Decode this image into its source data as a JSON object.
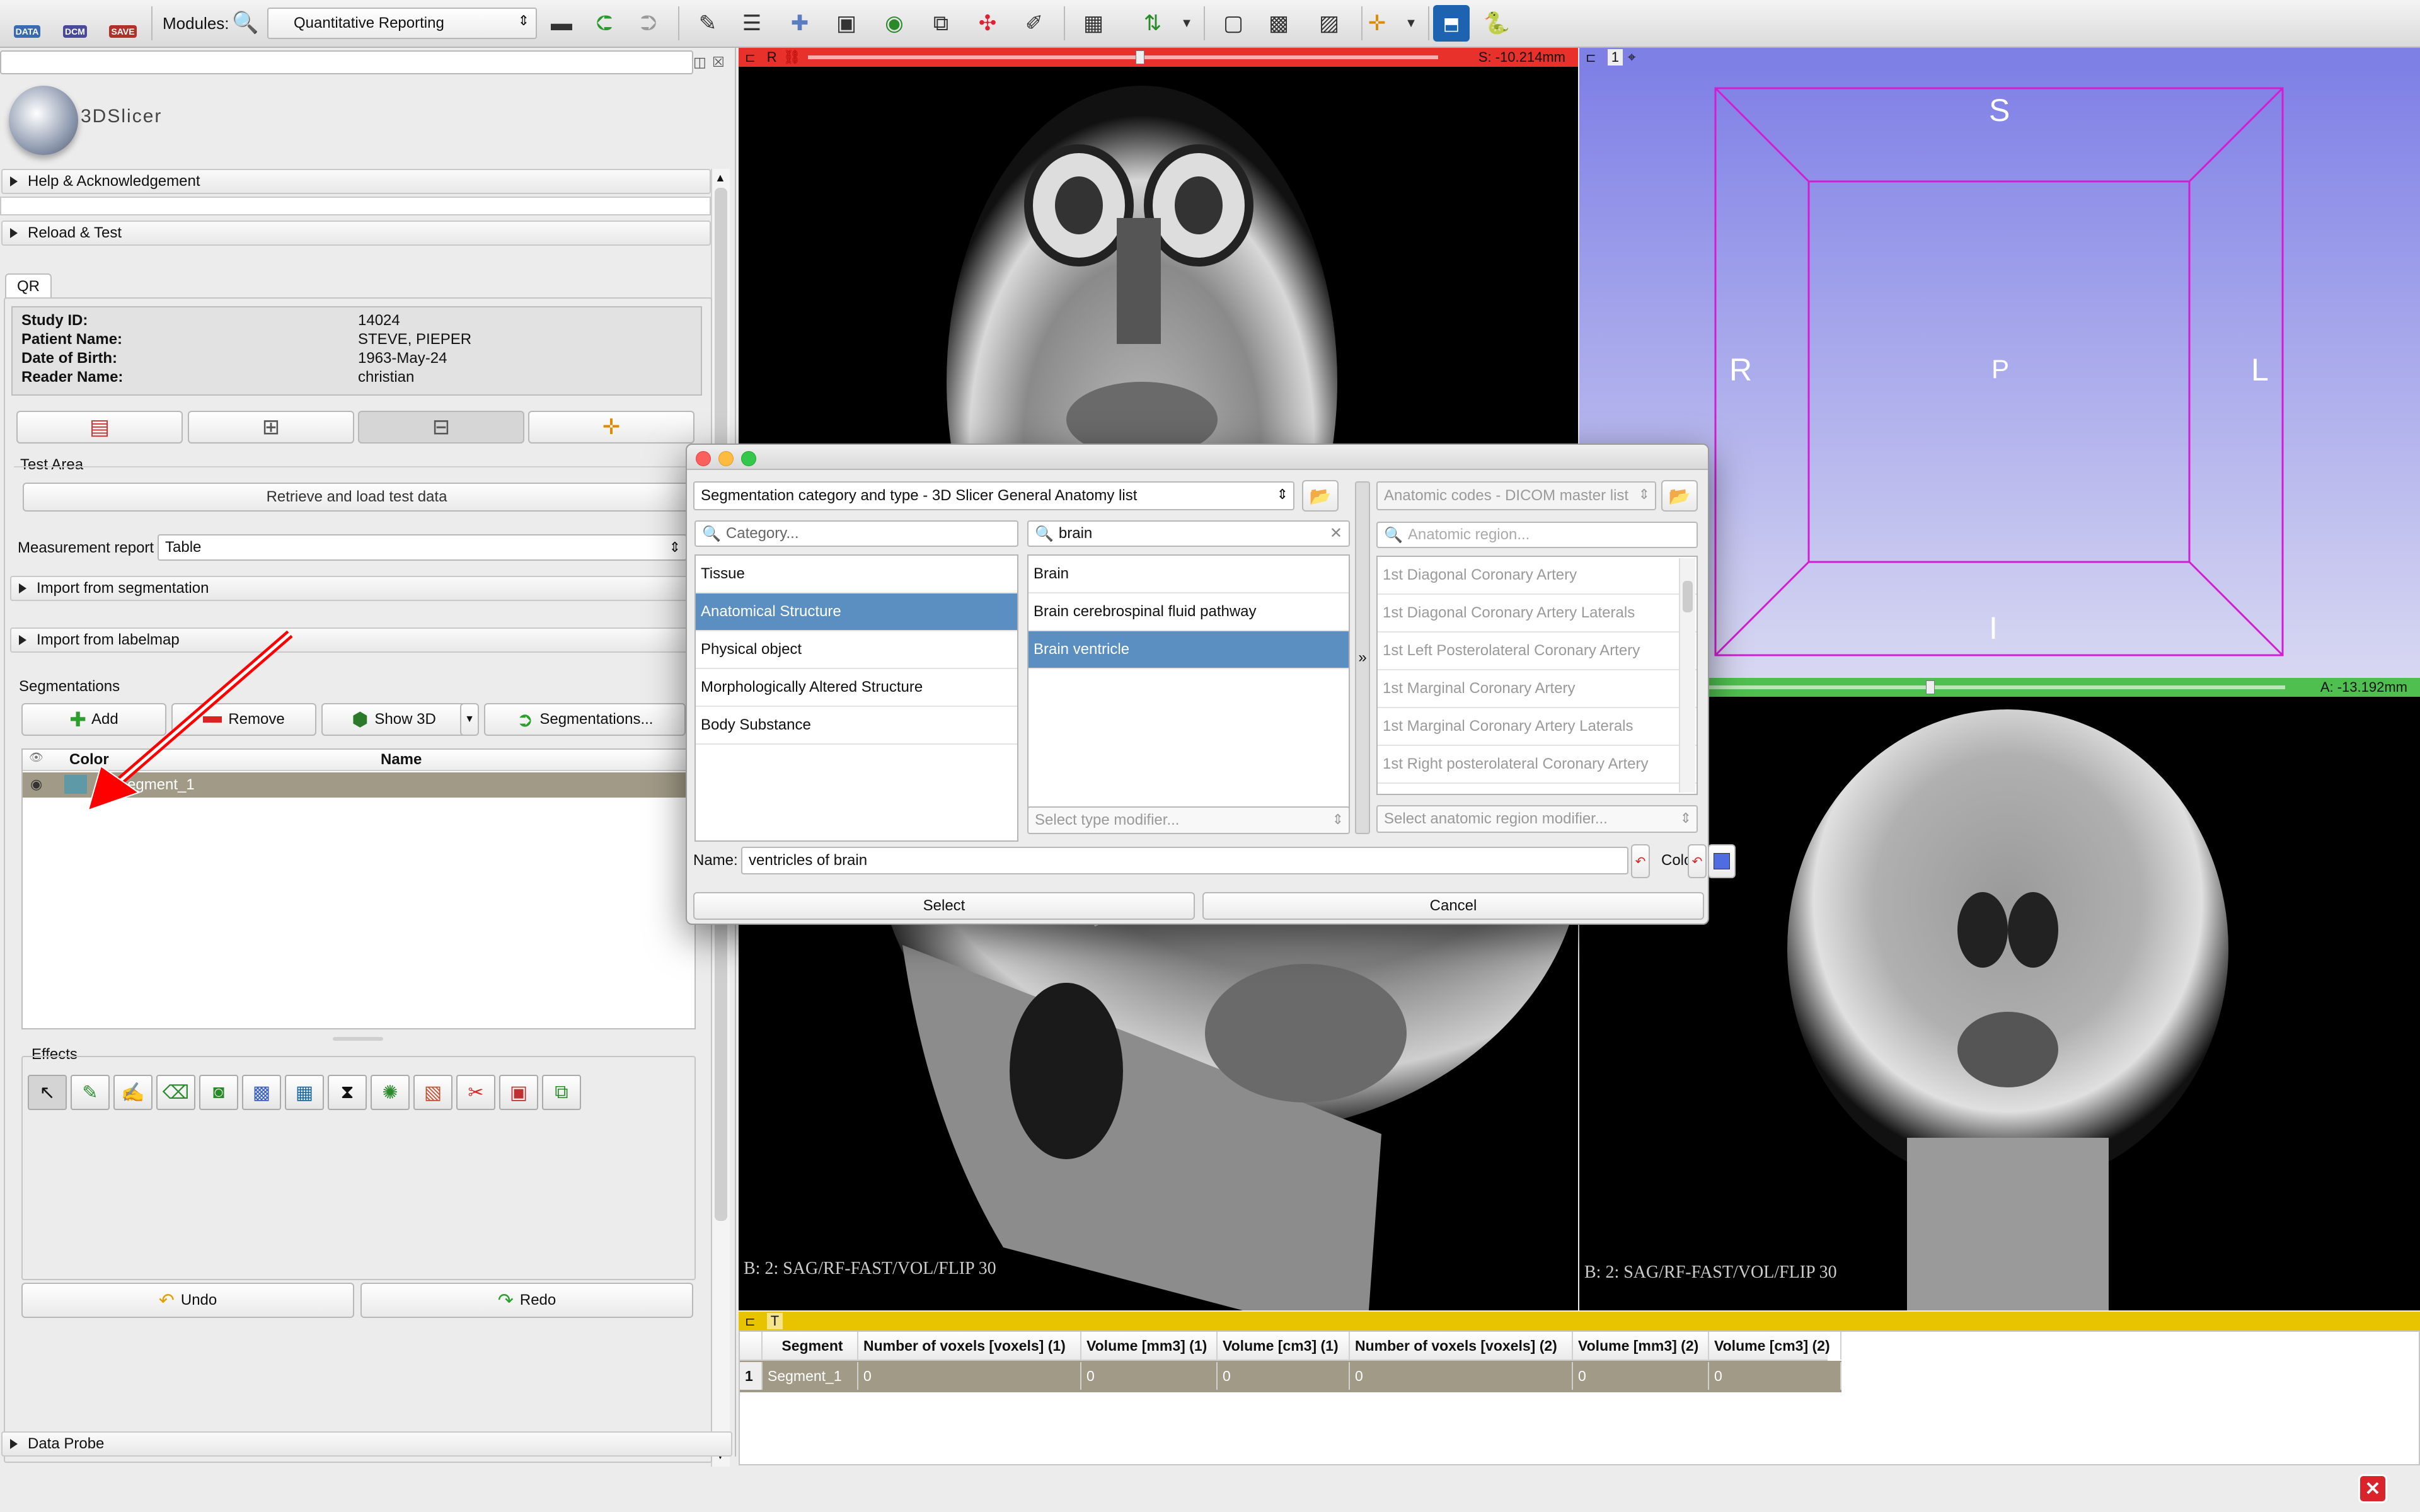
{
  "toolbar": {
    "data_label": "DATA",
    "dcm_label": "DCM",
    "save_label": "SAVE",
    "modules_label": "Modules:",
    "module_selected": "Quantitative Reporting"
  },
  "left": {
    "logo_text": "3DSlicer",
    "help_section": "Help & Acknowledgement",
    "reload_section": "Reload & Test",
    "tab": "QR",
    "info": [
      {
        "label": "Study ID:",
        "value": "14024"
      },
      {
        "label": "Patient Name:",
        "value": "STEVE, PIEPER"
      },
      {
        "label": "Date of Birth:",
        "value": "1963-May-24"
      },
      {
        "label": "Reader Name:",
        "value": "christian"
      }
    ],
    "test_area_title": "Test Area",
    "retrieve_button": "Retrieve and load test data",
    "measurement_label": "Measurement report",
    "measurement_value": "Table",
    "import_seg": "Import from segmentation",
    "import_label": "Import from labelmap",
    "segmentations_title": "Segmentations",
    "add_button": "Add",
    "remove_button": "Remove",
    "show3d_button": "Show 3D",
    "segmentations_button": "Segmentations...",
    "col_color": "Color",
    "col_name": "Name",
    "segment_name": "Segment_1",
    "effects_title": "Effects",
    "undo_button": "Undo",
    "redo_button": "Redo",
    "data_probe": "Data Probe"
  },
  "viewers": {
    "red_label": "R",
    "red_offset": "S: -10.214mm",
    "threed_label": "1",
    "orient_s": "S",
    "orient_i": "I",
    "orient_r": "R",
    "orient_l": "L",
    "orient_p": "P",
    "green_offset": "A: -13.192mm",
    "yellow_caption": "B: 2: SAG/RF-FAST/VOL/FLIP 30",
    "green_caption": "B: 2: SAG/RF-FAST/VOL/FLIP 30"
  },
  "dialog": {
    "terminology_select": "Segmentation category and type - 3D Slicer General Anatomy list",
    "category_placeholder": "Category...",
    "type_search": "brain",
    "anatomic_select": "Anatomic codes - DICOM master list",
    "anatomic_placeholder": "Anatomic region...",
    "categories": [
      "Tissue",
      "Anatomical Structure",
      "Physical object",
      "Morphologically Altered Structure",
      "Body Substance"
    ],
    "types": [
      "Brain",
      "Brain cerebrospinal fluid pathway",
      "Brain ventricle"
    ],
    "regions": [
      "1st Diagonal Coronary Artery",
      "1st Diagonal Coronary Artery Laterals",
      "1st Left Posterolateral Coronary Artery",
      "1st Marginal Coronary Artery",
      "1st Marginal Coronary Artery Laterals",
      "1st Right posterolateral Coronary Artery"
    ],
    "type_modifier_placeholder": "Select type modifier...",
    "region_modifier_placeholder": "Select anatomic region modifier...",
    "expand_glyph": "»",
    "name_label": "Name:",
    "name_value": "ventricles of brain",
    "color_label": "Color:",
    "select_button": "Select",
    "cancel_button": "Cancel"
  },
  "table": {
    "bar_label": "T",
    "headers": [
      "Segment",
      "Number of voxels [voxels] (1)",
      "Volume [mm3] (1)",
      "Volume [cm3] (1)",
      "Number of voxels [voxels] (2)",
      "Volume [mm3] (2)",
      "Volume [cm3] (2)"
    ],
    "row_index": "1",
    "row": [
      "Segment_1",
      "0",
      "0",
      "0",
      "0",
      "0",
      "0"
    ]
  },
  "colors": {
    "red_bar": "#e8312b",
    "green_bar": "#4fc04f",
    "yellow_bar": "#e8c400",
    "threed_bg_top": "#7f80e6",
    "threed_bg_bottom": "#d8d8f2",
    "selection": "#5b8fc1",
    "bbox_magenta": "#d21ed2"
  }
}
